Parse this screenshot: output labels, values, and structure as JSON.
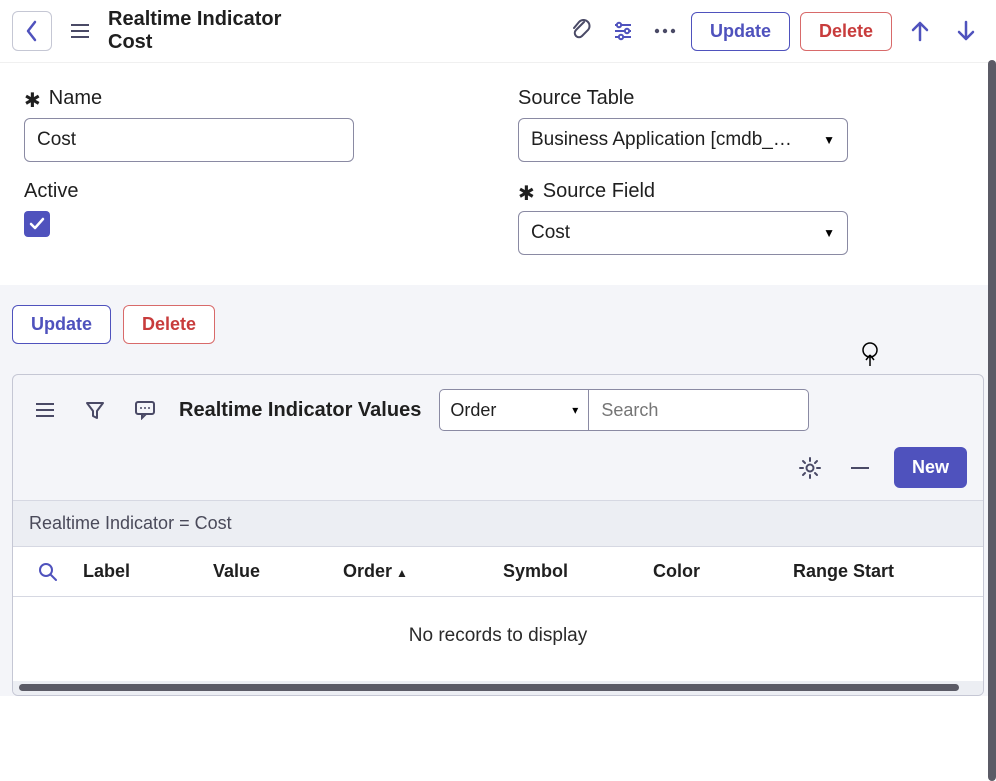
{
  "header": {
    "title_line1": "Realtime Indicator",
    "title_line2": "Cost",
    "update_label": "Update",
    "delete_label": "Delete"
  },
  "form": {
    "name_label": "Name",
    "name_value": "Cost",
    "active_label": "Active",
    "active_checked": true,
    "source_table_label": "Source Table",
    "source_table_value": "Business Application [cmdb_…",
    "source_field_label": "Source Field",
    "source_field_value": "Cost"
  },
  "button_bar": {
    "update_label": "Update",
    "delete_label": "Delete"
  },
  "related_list": {
    "title": "Realtime Indicator Values",
    "search_by_field": "Order",
    "search_placeholder": "Search",
    "new_label": "New",
    "filter_text": "Realtime Indicator = Cost",
    "columns": {
      "label": "Label",
      "value": "Value",
      "order": "Order",
      "symbol": "Symbol",
      "color": "Color",
      "range_start": "Range Start"
    },
    "sort_column": "order",
    "sort_dir": "asc",
    "empty_text": "No records to display"
  }
}
